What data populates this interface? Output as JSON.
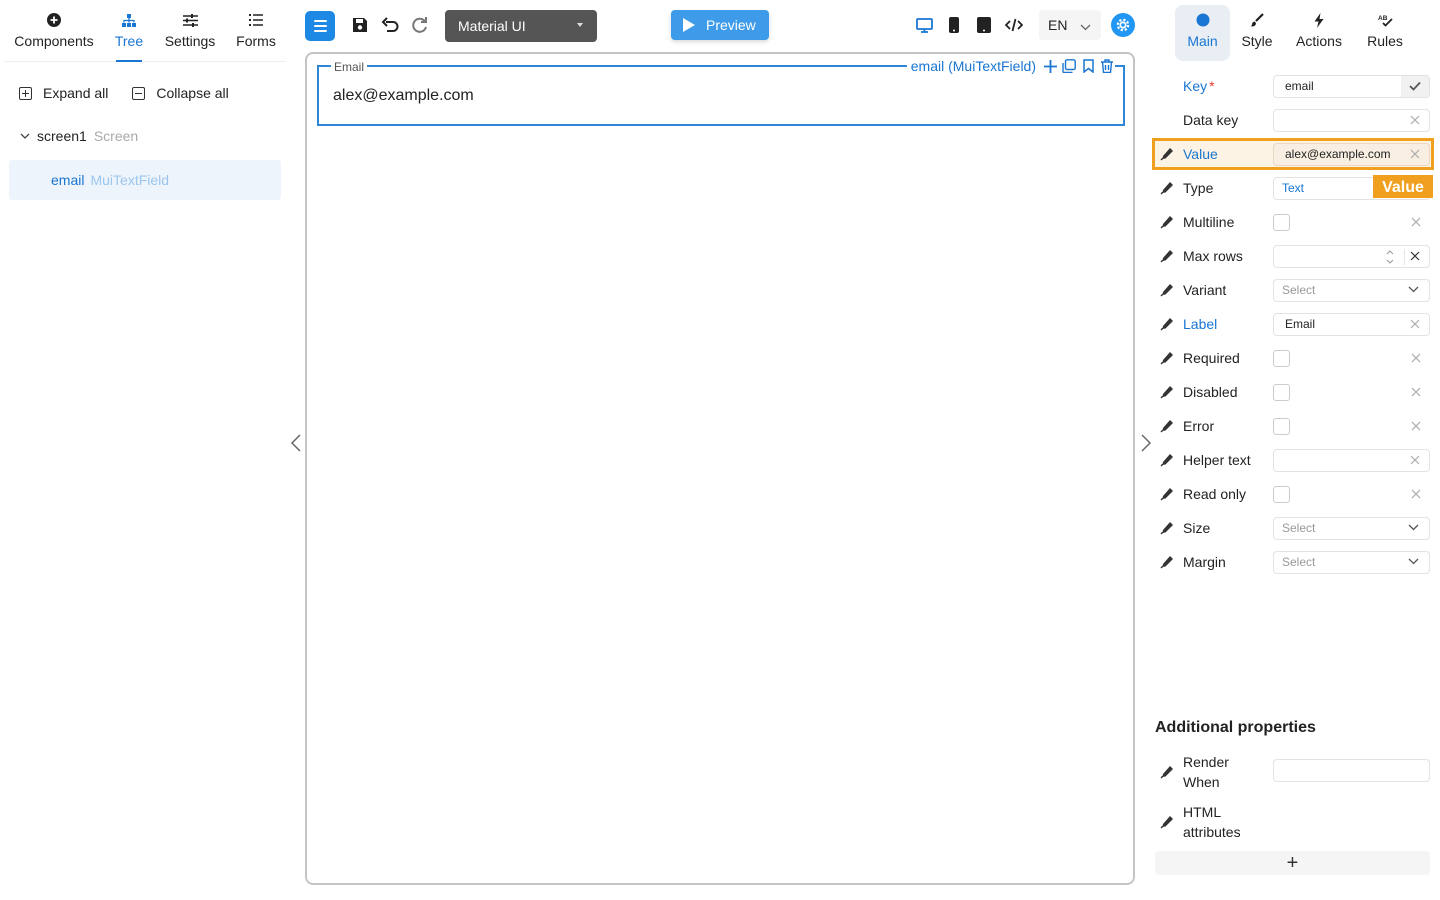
{
  "left_tabs": [
    {
      "label": "Components",
      "icon": "plus-circle-icon"
    },
    {
      "label": "Tree",
      "icon": "tree-icon",
      "active": true
    },
    {
      "label": "Settings",
      "icon": "sliders-icon"
    },
    {
      "label": "Forms",
      "icon": "list-icon"
    }
  ],
  "tree_actions": {
    "expand_all": "Expand all",
    "collapse_all": "Collapse all"
  },
  "tree": {
    "screen": {
      "name": "screen1",
      "type": "Screen"
    },
    "item": {
      "name": "email",
      "type": "MuiTextField"
    }
  },
  "toolbar": {
    "library": "Material UI",
    "preview": "Preview",
    "language": "EN",
    "icons": [
      "menu-icon",
      "save-icon",
      "undo-icon",
      "redo-icon",
      "desktop-icon",
      "phone-icon",
      "tablet-icon",
      "code-icon",
      "gear-icon"
    ]
  },
  "canvas": {
    "field_label": "Email",
    "field_value": "alex@example.com",
    "selection_tag": "email (MuiTextField)"
  },
  "right_tabs": [
    {
      "label": "Main",
      "icon": "circle-icon",
      "active": true
    },
    {
      "label": "Style",
      "icon": "brush-icon"
    },
    {
      "label": "Actions",
      "icon": "bolt-icon"
    },
    {
      "label": "Rules",
      "icon": "spellcheck-icon"
    }
  ],
  "props": {
    "key": {
      "label": "Key",
      "required_mark": "*",
      "value": "email"
    },
    "data_key": {
      "label": "Data key",
      "value": ""
    },
    "value": {
      "label": "Value",
      "value": "alex@example.com"
    },
    "type": {
      "label": "Type",
      "value": "Text"
    },
    "multiline": {
      "label": "Multiline"
    },
    "max_rows": {
      "label": "Max rows",
      "value": ""
    },
    "variant": {
      "label": "Variant",
      "placeholder": "Select"
    },
    "label": {
      "label": "Label",
      "value": "Email"
    },
    "required": {
      "label": "Required"
    },
    "disabled": {
      "label": "Disabled"
    },
    "error": {
      "label": "Error"
    },
    "helper_text": {
      "label": "Helper text",
      "value": ""
    },
    "read_only": {
      "label": "Read only"
    },
    "size": {
      "label": "Size",
      "placeholder": "Select"
    },
    "margin": {
      "label": "Margin",
      "placeholder": "Select"
    }
  },
  "highlight_tag": "Value",
  "additional": {
    "title": "Additional properties",
    "render_when": {
      "label_1": "Render",
      "label_2": "When"
    },
    "html_attributes": {
      "label_1": "HTML",
      "label_2": "attributes"
    },
    "add_label": "+"
  },
  "colors": {
    "accent": "#1976d2",
    "highlight": "#f0a01e",
    "library_bg": "#555555",
    "preview_bg": "#3d9be9"
  }
}
